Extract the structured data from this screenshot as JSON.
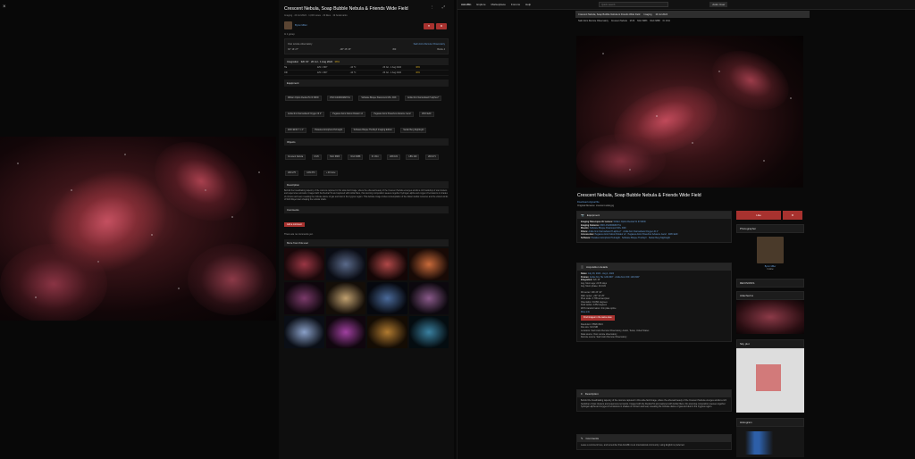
{
  "left": {
    "close_icon": "×",
    "panel": {
      "title": "Crescent Nebula, Soap Bubble Nebula & Friends Wide Field",
      "meta": "Imaging · 29 Jul 2024 · 1,003 views · 29 likes · 19 bookmarks",
      "author": "Byron Miller",
      "group_text": "In 1 group",
      "remote_obs": "Own remote observatory",
      "obs_name": "Sadr Astro Remote Observatory",
      "lat": "30° 16' 27\"",
      "lon": "-98° 45' 25\"",
      "alt": "450",
      "bortle": "Bortle 4",
      "integration_label": "Integration",
      "integration_total": "32h 15'",
      "integration_dates": "26 Jul - 1 Aug 2024",
      "integration_pct": "38%",
      "acq_rows": [
        {
          "filter": "Ha",
          "exp": "129 × 300\"",
          "temp": "-10 °C",
          "date": "26 Jul - 1 Aug 2024",
          "pct": "38%"
        },
        {
          "filter": "OIII",
          "exp": "129 × 300\"",
          "temp": "-10 °C",
          "date": "26 Jul - 1 Aug 2024",
          "pct": "38%"
        }
      ],
      "equipment_label": "Equipment",
      "equipment_tags": [
        "William Optics Redcat 51 III WIFD",
        "ZWO ASI2600MM Pro",
        "Software Bisque Paramount MX+ D2K",
        "Antlia 3nm Narrowband H-alpha 2\"",
        "Antlia 3nm Narrowband Oxygen III 2\"",
        "Pegasus Astro Falcon Rotator v2",
        "Pegasus Astro Powerbox Advance Gen2",
        "ZWO EAF",
        "ZWO EFW 7 × 2\"",
        "Pleiades Astrophoto PixInsight",
        "Software Bisque TheSkyX Imaging Edition",
        "Stefan Berg NightLight"
      ],
      "objects_label": "Objects",
      "object_tags": [
        "Crescent Nebula",
        "M 29",
        "NGC 6883",
        "NGC 6888",
        "IC 1311",
        "LBN 181",
        "LBN 229",
        "LBN 271",
        "LBN 275",
        "LDN 870",
        "+ 49 more"
      ],
      "description_label": "Description",
      "description": "Behold the breathtaking tapestry of the cosmos captured in this wide-field image, where the ethereal beauty of the Crescent Nebula emerges amidst a rich backdrop of star clusters and supernova remnants. Imaged with the Redcat 51 and captured with Antlia filters, this stunning composition weaves together hydrogen-alpha and oxygen-III emissions in shades of crimson and teal, revealing the intricate dance of gas and dust in the Cygnus region. This delicate image invites contemplation of the distant stellar nurseries and the violent winds of Wolf-Rayet stars shaping the nebular shells.",
      "comments_label": "Comments",
      "add_comment": "Add a comment",
      "no_comments": "There are no comments yet.",
      "more_label": "More from this user"
    }
  },
  "right": {
    "nav": [
      "AstroBin",
      "Explore",
      "Marketplace",
      "Forums",
      "Help"
    ],
    "search_placeholder": "Quick search",
    "user_label": "Astro User",
    "subbar": [
      "Crescent Nebula, Soap Bubble Nebula & Friends Wide Field",
      "Imaging",
      "29 Jul 2024"
    ],
    "subbar2": [
      "Sadr Astro Remote Observatory",
      "Crescent Nebula",
      "M 29",
      "NGC 6883",
      "NGC 6888",
      "IC 1311"
    ],
    "title": "Crescent Nebula, Soap Bubble Nebula & Friends Wide Field",
    "download_label": "Download original file",
    "original_filename": "Original filename: crescent-wide.jpg",
    "equipment": {
      "label": "Equipment",
      "telescope": "William Optics Redcat 51 III WIFD",
      "camera": "ZWO ASI2600MM Pro",
      "mount": "Software Bisque Paramount MX+ D2K",
      "filters": "Antlia 3nm Narrowband H-alpha 2\" · Antlia 3nm Narrowband Oxygen III 2\"",
      "accessories": "Pegasus Astro Falcon Rotator v2 · Pegasus Astro Powerbox Advance Gen2 · ZWO EAF",
      "software": "Pleiades Astrophoto PixInsight · Software Bisque TheSkyX · Stefan Berg NightLight"
    },
    "acquisition": {
      "label": "Acquisition details",
      "dates": "July 26, 2024 - Aug 1, 2024",
      "frames": "Antlia 3nm Ha: 129×300\" · Antlia 3nm OIII: 129×300\"",
      "integration": "32h 15'",
      "moon_age": "Avg. Moon age: 24.53 days",
      "moon_phase": "Avg. Moon phase: 26.01%"
    },
    "astrometry": {
      "ra": "RA center: 20h 23' 42\"",
      "dec": "DEC center: +39° 10' 25\"",
      "pixel_scale": "Pixel scale: 3.785 arcsec/pixel",
      "orientation": "Orientation: 94.894 degrees",
      "field_radius": "Field radius: 4.852 degrees",
      "wcs": "WCS transformation: thin plate spline",
      "more_info": "More info",
      "find_images": "Find images in the same area"
    },
    "resolution": "Resolution: 5568×3624",
    "file_size": "File size: 34.9 MB",
    "locations": "Locations: Sadr Astro Remote Observatory, Austin, Texas, United States",
    "data_source": "Data source: Own remote observatory",
    "remote_source": "Remote source: Sadr Astro Remote Observatory",
    "description_label": "Description",
    "description": "Behold the breathtaking tapestry of the cosmos captured in this wide-field image, where the ethereal beauty of the Crescent Nebula emerges amidst a rich backdrop of star clusters and supernova remnants. Imaged with the Redcat 51 and captured with Antlia filters, this stunning composition weaves together hydrogen-alpha and oxygen-III emissions in shades of crimson and teal, revealing the intricate dance of gas and dust in the Cygnus region.",
    "comments_label": "Comments",
    "comments_note": "Leave a comment here, and remember that AstroBin is an international community: using English is preferred.",
    "like_label": "Like",
    "photographer_label": "Photographer",
    "photographer_name": "Byron Miller",
    "followers": "Follow",
    "revisions_label": "REVISIONS",
    "attached_label": "Attached to",
    "sky_plot_label": "Sky plot",
    "histogram_label": "Histogram"
  },
  "colors": {
    "accent": "#a8322f",
    "link": "#6a9fd8",
    "warn": "#c8a020"
  }
}
